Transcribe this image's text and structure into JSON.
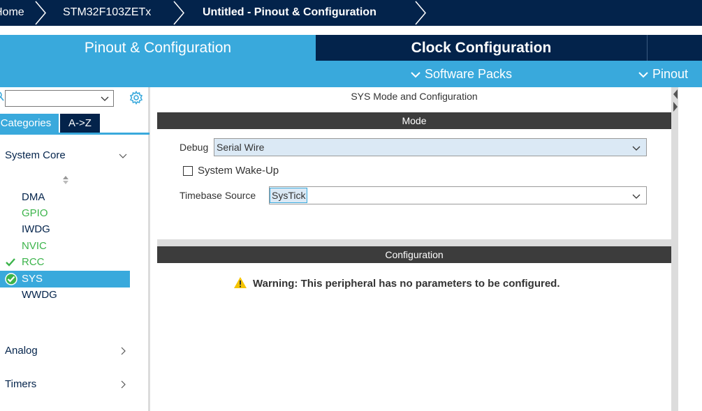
{
  "breadcrumb": {
    "items": [
      "Home",
      "STM32F103ZETx",
      "Untitled - Pinout & Configuration"
    ]
  },
  "tabs": {
    "pinout": "Pinout & Configuration",
    "clock": "Clock Configuration"
  },
  "submenu": {
    "software_packs": "Software Packs",
    "pinout": "Pinout"
  },
  "sidebar": {
    "search_value": "",
    "category_tabs": [
      "Categories",
      "A->Z"
    ],
    "groups": {
      "system_core": "System Core",
      "analog": "Analog",
      "timers": "Timers"
    },
    "items": [
      {
        "label": "DMA",
        "status": "none"
      },
      {
        "label": "GPIO",
        "status": "green"
      },
      {
        "label": "IWDG",
        "status": "none"
      },
      {
        "label": "NVIC",
        "status": "green"
      },
      {
        "label": "RCC",
        "status": "checked"
      },
      {
        "label": "SYS",
        "status": "selected"
      },
      {
        "label": "WWDG",
        "status": "none"
      }
    ]
  },
  "main": {
    "title": "SYS Mode and Configuration",
    "mode_header": "Mode",
    "debug_label": "Debug",
    "debug_value": "Serial Wire",
    "wakeup_label": "System Wake-Up",
    "wakeup_checked": false,
    "timebase_label": "Timebase Source",
    "timebase_value": "SysTick",
    "config_header": "Configuration",
    "warning": "Warning: This peripheral has no parameters to be configured."
  },
  "colors": {
    "navy": "#03234b",
    "accent_blue": "#39a9dc",
    "ok_green": "#3cb44b",
    "section_bar": "#3c3c3c",
    "warning_yellow": "#f5c400"
  },
  "icons": [
    "search-icon",
    "gear-icon",
    "chevron-down-icon",
    "chevron-right-icon",
    "sort-icon",
    "check-icon",
    "circle-check-icon",
    "warning-icon"
  ]
}
